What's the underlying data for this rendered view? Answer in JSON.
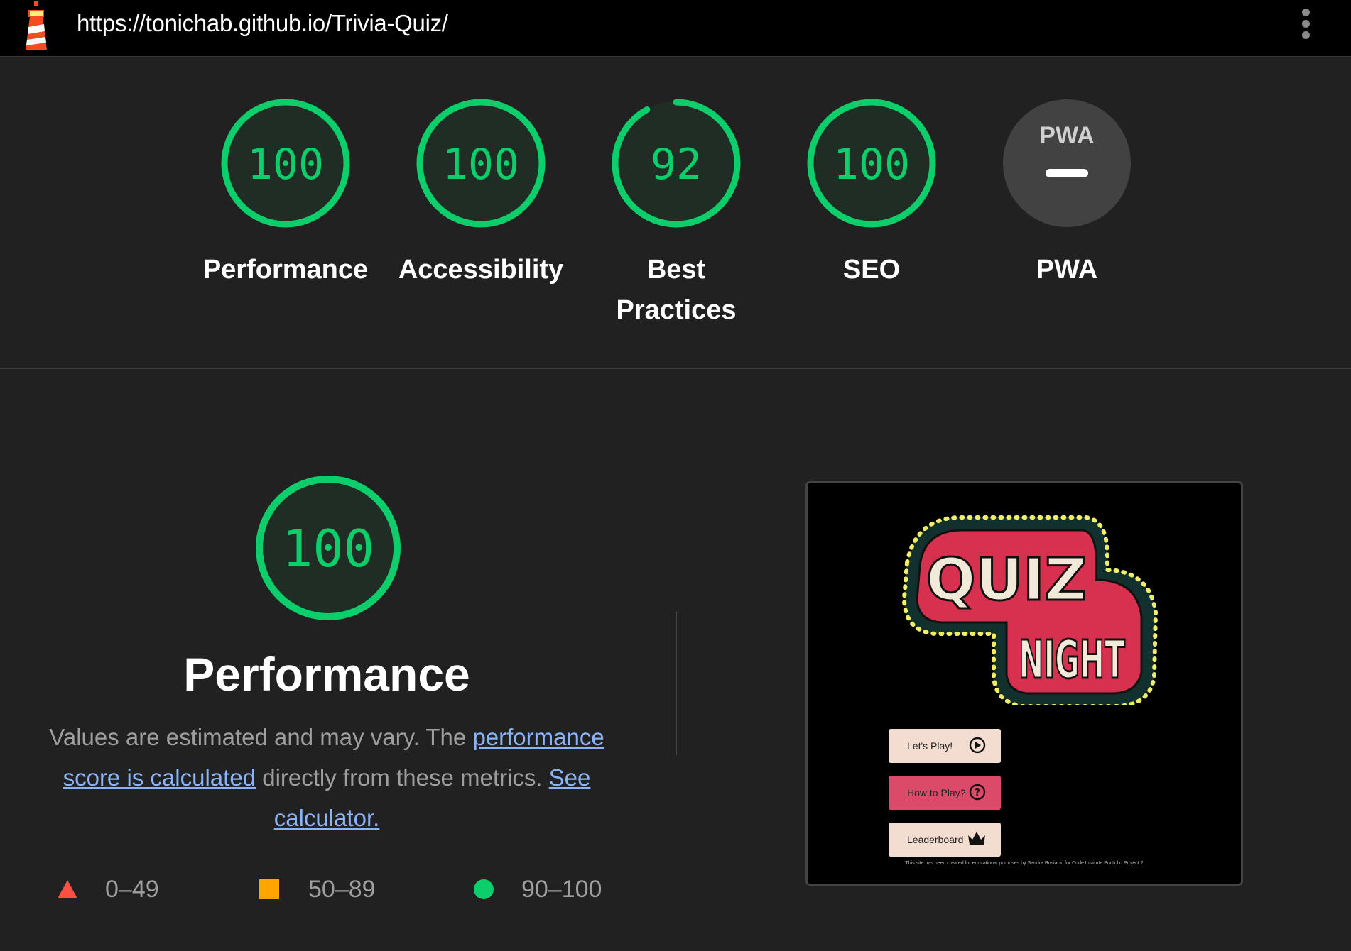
{
  "header": {
    "url": "https://tonichab.github.io/Trivia-Quiz/",
    "logo_icon": "lighthouse-icon",
    "menu_icon": "more-vert-icon"
  },
  "colors": {
    "pass": "#0cce6b",
    "average": "#ffa400",
    "fail": "#ff4e42",
    "pwa_gray": "#424242"
  },
  "categories": [
    {
      "label": "Performance",
      "score": "100",
      "value": 1.0
    },
    {
      "label": "Accessibility",
      "score": "100",
      "value": 1.0
    },
    {
      "label": "Best Practices",
      "label_line1": "Best",
      "label_line2": "Practices",
      "score": "92",
      "value": 0.92
    },
    {
      "label": "SEO",
      "score": "100",
      "value": 1.0
    },
    {
      "label": "PWA",
      "badge": "PWA",
      "score": ""
    }
  ],
  "performance": {
    "score": "100",
    "title": "Performance",
    "desc_prefix": "Values are estimated and may vary. The ",
    "link_score": "performance score is calculated",
    "desc_middle": " directly from these metrics. ",
    "link_calc": "See calculator."
  },
  "legend": [
    {
      "shape": "triangle",
      "range": "0–49"
    },
    {
      "shape": "square",
      "range": "50–89"
    },
    {
      "shape": "circle",
      "range": "90–100"
    }
  ],
  "screenshot": {
    "logo_word1": "QUIZ",
    "logo_word2": "NIGHT",
    "buttons": [
      {
        "label": "Let's Play!",
        "icon": "play-circle-icon"
      },
      {
        "label": "How to Play?",
        "icon": "help-circle-icon"
      },
      {
        "label": "Leaderboard",
        "icon": "crown-icon"
      }
    ],
    "footer": "This site has been created for educational purposes by Sandra Bosiacki for Code Institute Portfolio Project 2"
  }
}
